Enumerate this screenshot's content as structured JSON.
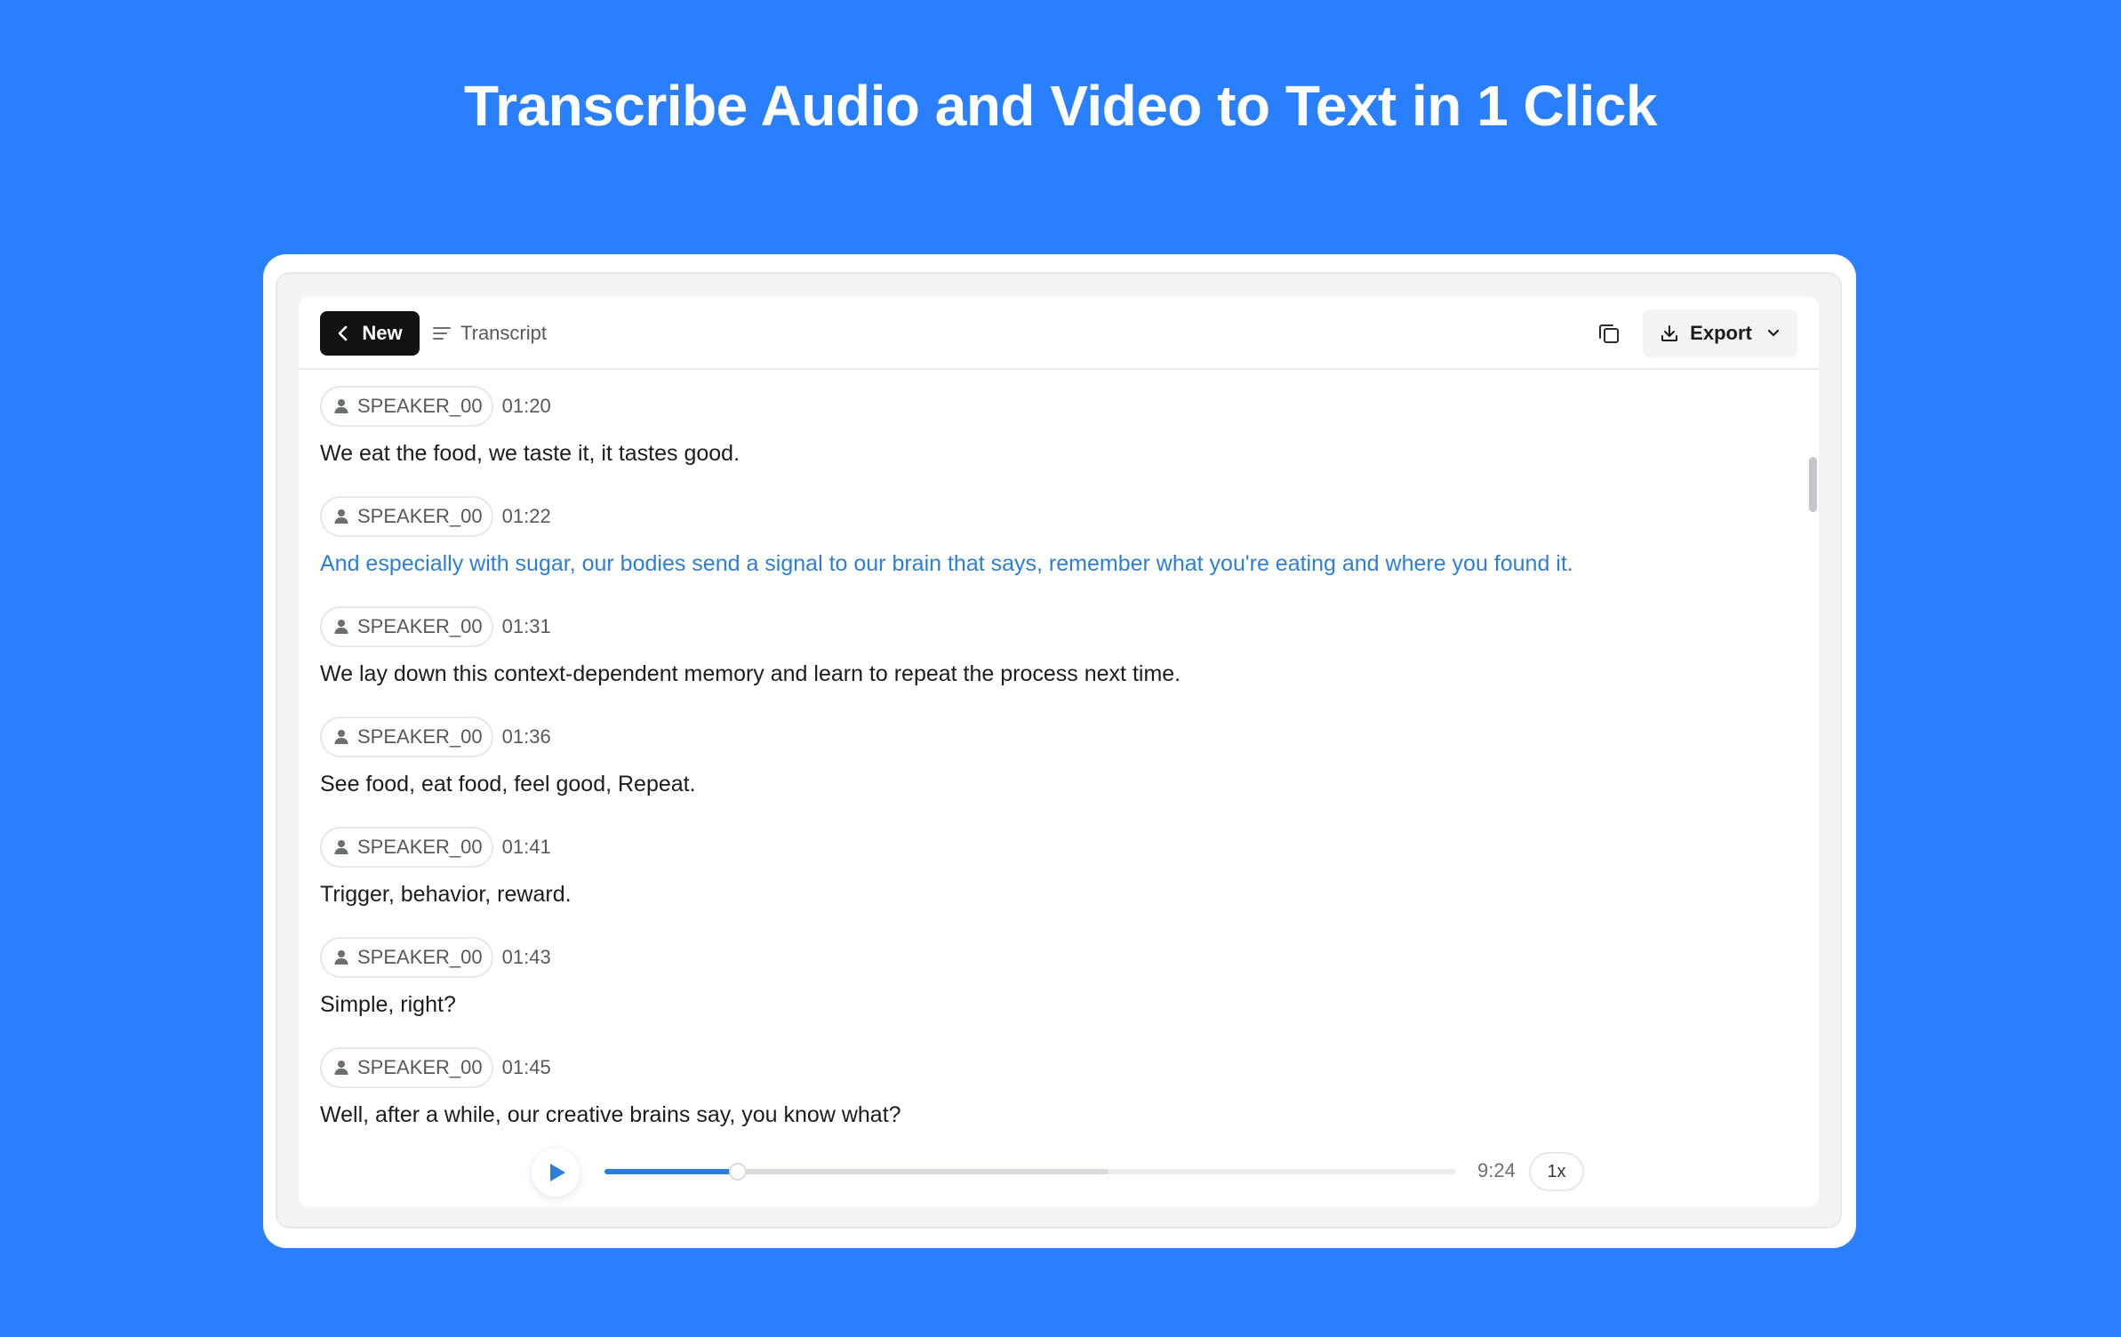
{
  "page": {
    "title": "Transcribe Audio and Video to Text in 1 Click"
  },
  "toolbar": {
    "new_label": "New",
    "tab_label": "Transcript",
    "export_label": "Export"
  },
  "segments": [
    {
      "speaker": "SPEAKER_00",
      "time": "01:20",
      "text": "We eat the food, we taste it, it tastes good.",
      "active": false
    },
    {
      "speaker": "SPEAKER_00",
      "time": "01:22",
      "text": "And especially with sugar, our bodies send a signal to our brain that says, remember what you're eating and where you found it.",
      "active": true
    },
    {
      "speaker": "SPEAKER_00",
      "time": "01:31",
      "text": "We lay down this context-dependent memory and learn to repeat the process next time.",
      "active": false
    },
    {
      "speaker": "SPEAKER_00",
      "time": "01:36",
      "text": "See food, eat food, feel good, Repeat.",
      "active": false
    },
    {
      "speaker": "SPEAKER_00",
      "time": "01:41",
      "text": "Trigger, behavior, reward.",
      "active": false
    },
    {
      "speaker": "SPEAKER_00",
      "time": "01:43",
      "text": "Simple, right?",
      "active": false
    },
    {
      "speaker": "SPEAKER_00",
      "time": "01:45",
      "text": "Well, after a while, our creative brains say, you know what?",
      "active": false
    }
  ],
  "player": {
    "duration": "9:24",
    "speed": "1x",
    "progress_fraction": 0.157,
    "buffered_fraction": 0.592
  },
  "colors": {
    "background": "#2a7fff",
    "accent": "#2b7fd9",
    "new_button": "#111214"
  },
  "icons": {
    "back": "chevron-left-icon",
    "transcript": "lines-icon",
    "copy": "copy-icon",
    "download": "download-icon",
    "dropdown": "chevron-down-icon",
    "speaker": "user-icon",
    "play": "play-icon"
  }
}
